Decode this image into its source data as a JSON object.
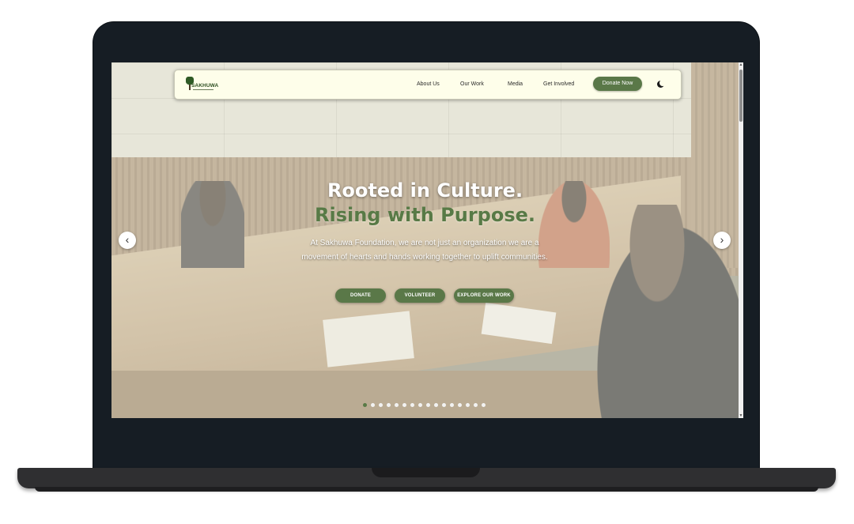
{
  "navbar": {
    "logo_text": "SAKHUWA",
    "links": [
      "About Us",
      "Our Work",
      "Media",
      "Get Involved"
    ],
    "donate_label": "Donate Now",
    "theme_icon": "moon-icon"
  },
  "hero": {
    "title_line1": "Rooted in Culture.",
    "title_line2": "Rising with Purpose.",
    "description": "At Sakhuwa Foundation, we are not just an organization we are a movement of hearts and hands working together to uplift communities.",
    "buttons": [
      "DONATE",
      "VOLUNTEER",
      "EXPLORE OUR WORK"
    ]
  },
  "carousel": {
    "prev_icon": "‹",
    "next_icon": "›",
    "slide_count": 16,
    "active_slide": 1
  },
  "colors": {
    "accent": "#5a7848",
    "navbar_bg": "#fefeea",
    "laptop_frame": "#161d24"
  }
}
